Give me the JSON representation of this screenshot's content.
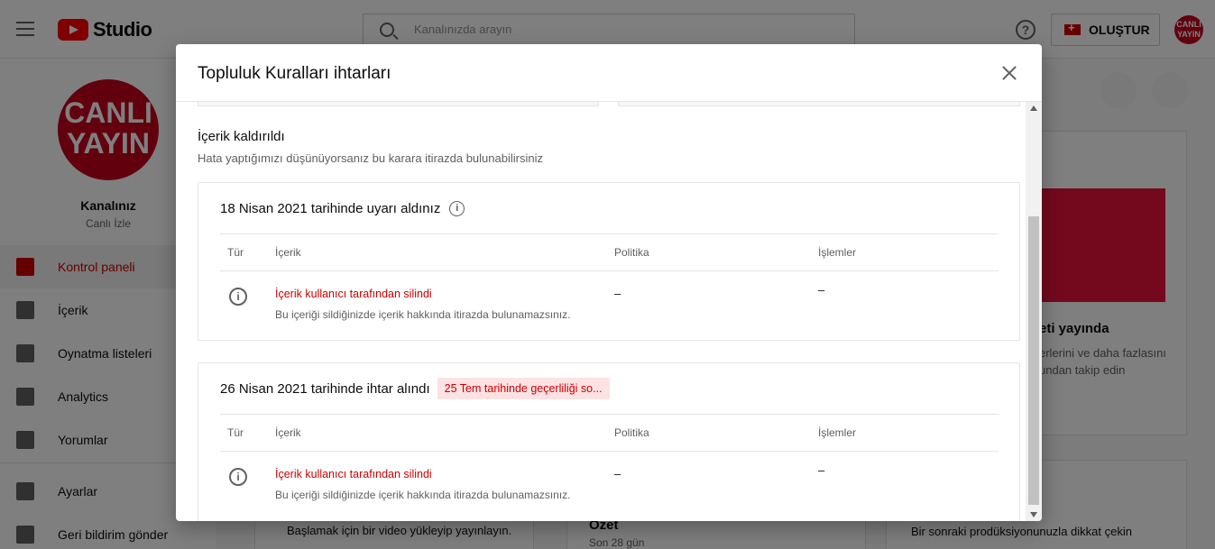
{
  "header": {
    "app_name": "Studio",
    "search_placeholder": "Kanalınızda arayın",
    "create_label": "OLUŞTUR",
    "help_glyph": "?",
    "avatar_text": "CANLI YAYIN"
  },
  "sidebar": {
    "channel_avatar_line1": "CANLI",
    "channel_avatar_line2": "YAYIN",
    "channel_name": "Kanalınız",
    "channel_sub": "Canlı İzle",
    "items": [
      {
        "label": "Kontrol paneli",
        "icon": "dashboard-icon"
      },
      {
        "label": "İçerik",
        "icon": "content-icon"
      },
      {
        "label": "Oynatma listeleri",
        "icon": "playlist-icon"
      },
      {
        "label": "Analytics",
        "icon": "analytics-icon"
      },
      {
        "label": "Yorumlar",
        "icon": "comments-icon"
      },
      {
        "label": "Ayarlar",
        "icon": "settings-icon"
      },
      {
        "label": "Geri bildirim gönder",
        "icon": "feedback-icon"
      }
    ]
  },
  "background": {
    "promo_title": "eti yayında",
    "promo_line1": "erlerini ve daha fazlasını",
    "promo_line2": "undan takip edin",
    "upload_hint": "Başlamak için bir video yükleyip yayınlayın.",
    "summary_title": "Özet",
    "summary_period": "Son 28 gün",
    "next_prod": "Bir sonraki prodüksiyonunuzla dikkat çekin"
  },
  "dialog": {
    "title": "Topluluk Kuralları ihtarları",
    "section_title": "İçerik kaldırıldı",
    "section_sub": "Hata yaptığımızı düşünüyorsanız bu karara itirazda bulunabilirsiniz",
    "columns": {
      "type": "Tür",
      "content": "İçerik",
      "policy": "Politika",
      "actions": "İşlemler"
    },
    "strikes": [
      {
        "heading": "18 Nisan 2021 tarihinde uyarı aldınız",
        "badge": "",
        "row_title": "İçerik kullanıcı tarafından silindi",
        "row_desc": "Bu içeriği sildiğinizde içerik hakkında itirazda bulunamazsınız.",
        "policy": "–",
        "actions": "–"
      },
      {
        "heading": "26 Nisan 2021 tarihinde ihtar alındı",
        "badge": "25 Tem tarihinde geçerliliği so...",
        "row_title": "İçerik kullanıcı tarafından silindi",
        "row_desc": "Bu içeriği sildiğinizde içerik hakkında itirazda bulunamazsınız.",
        "policy": "–",
        "actions": "–"
      }
    ]
  }
}
